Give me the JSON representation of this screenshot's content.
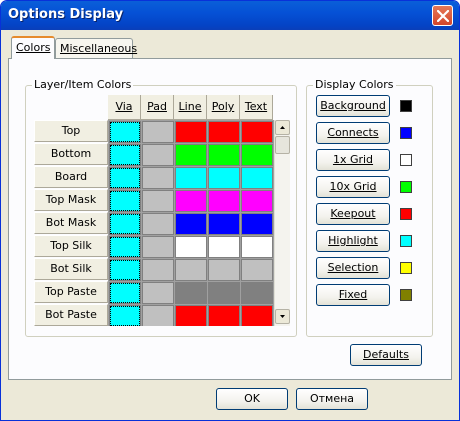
{
  "window": {
    "title": "Options Display"
  },
  "tabs": [
    {
      "label": "Colors",
      "active": true
    },
    {
      "label": "Miscellaneous",
      "active": false
    }
  ],
  "layer_group": {
    "title": "Layer/Item Colors",
    "columns": [
      "Via",
      "Pad",
      "Line",
      "Poly",
      "Text"
    ],
    "rows": [
      {
        "label": "Top",
        "colors": [
          "#00ffff",
          "#c0c0c0",
          "#ff0000",
          "#ff0000",
          "#ff0000"
        ]
      },
      {
        "label": "Bottom",
        "colors": [
          "#00ffff",
          "#c0c0c0",
          "#00ff00",
          "#00ff00",
          "#00ff00"
        ]
      },
      {
        "label": "Board",
        "colors": [
          "#00ffff",
          "#c0c0c0",
          "#00ffff",
          "#00ffff",
          "#00ffff"
        ]
      },
      {
        "label": "Top Mask",
        "colors": [
          "#00ffff",
          "#c0c0c0",
          "#ff00ff",
          "#ff00ff",
          "#ff00ff"
        ]
      },
      {
        "label": "Bot Mask",
        "colors": [
          "#00ffff",
          "#c0c0c0",
          "#0000ff",
          "#0000ff",
          "#0000ff"
        ]
      },
      {
        "label": "Top Silk",
        "colors": [
          "#00ffff",
          "#c0c0c0",
          "#ffffff",
          "#ffffff",
          "#ffffff"
        ]
      },
      {
        "label": "Bot Silk",
        "colors": [
          "#00ffff",
          "#c0c0c0",
          "#c0c0c0",
          "#c0c0c0",
          "#c0c0c0"
        ]
      },
      {
        "label": "Top Paste",
        "colors": [
          "#00ffff",
          "#c0c0c0",
          "#808080",
          "#808080",
          "#808080"
        ]
      },
      {
        "label": "Bot Paste",
        "colors": [
          "#00ffff",
          "#c0c0c0",
          "#ff0000",
          "#ff0000",
          "#ff0000"
        ]
      }
    ]
  },
  "display_group": {
    "title": "Display Colors",
    "items": [
      {
        "label": "Background",
        "color": "#000000"
      },
      {
        "label": "Connects",
        "color": "#0000ff"
      },
      {
        "label": "1x Grid",
        "color": "#ffffff"
      },
      {
        "label": "10x Grid",
        "color": "#00ff00"
      },
      {
        "label": "Keepout",
        "color": "#ff0000"
      },
      {
        "label": "Highlight",
        "color": "#00ffff"
      },
      {
        "label": "Selection",
        "color": "#ffff00"
      },
      {
        "label": "Fixed",
        "color": "#808000"
      }
    ]
  },
  "buttons": {
    "defaults": "Defaults",
    "ok": "OK",
    "cancel": "Отмена"
  }
}
